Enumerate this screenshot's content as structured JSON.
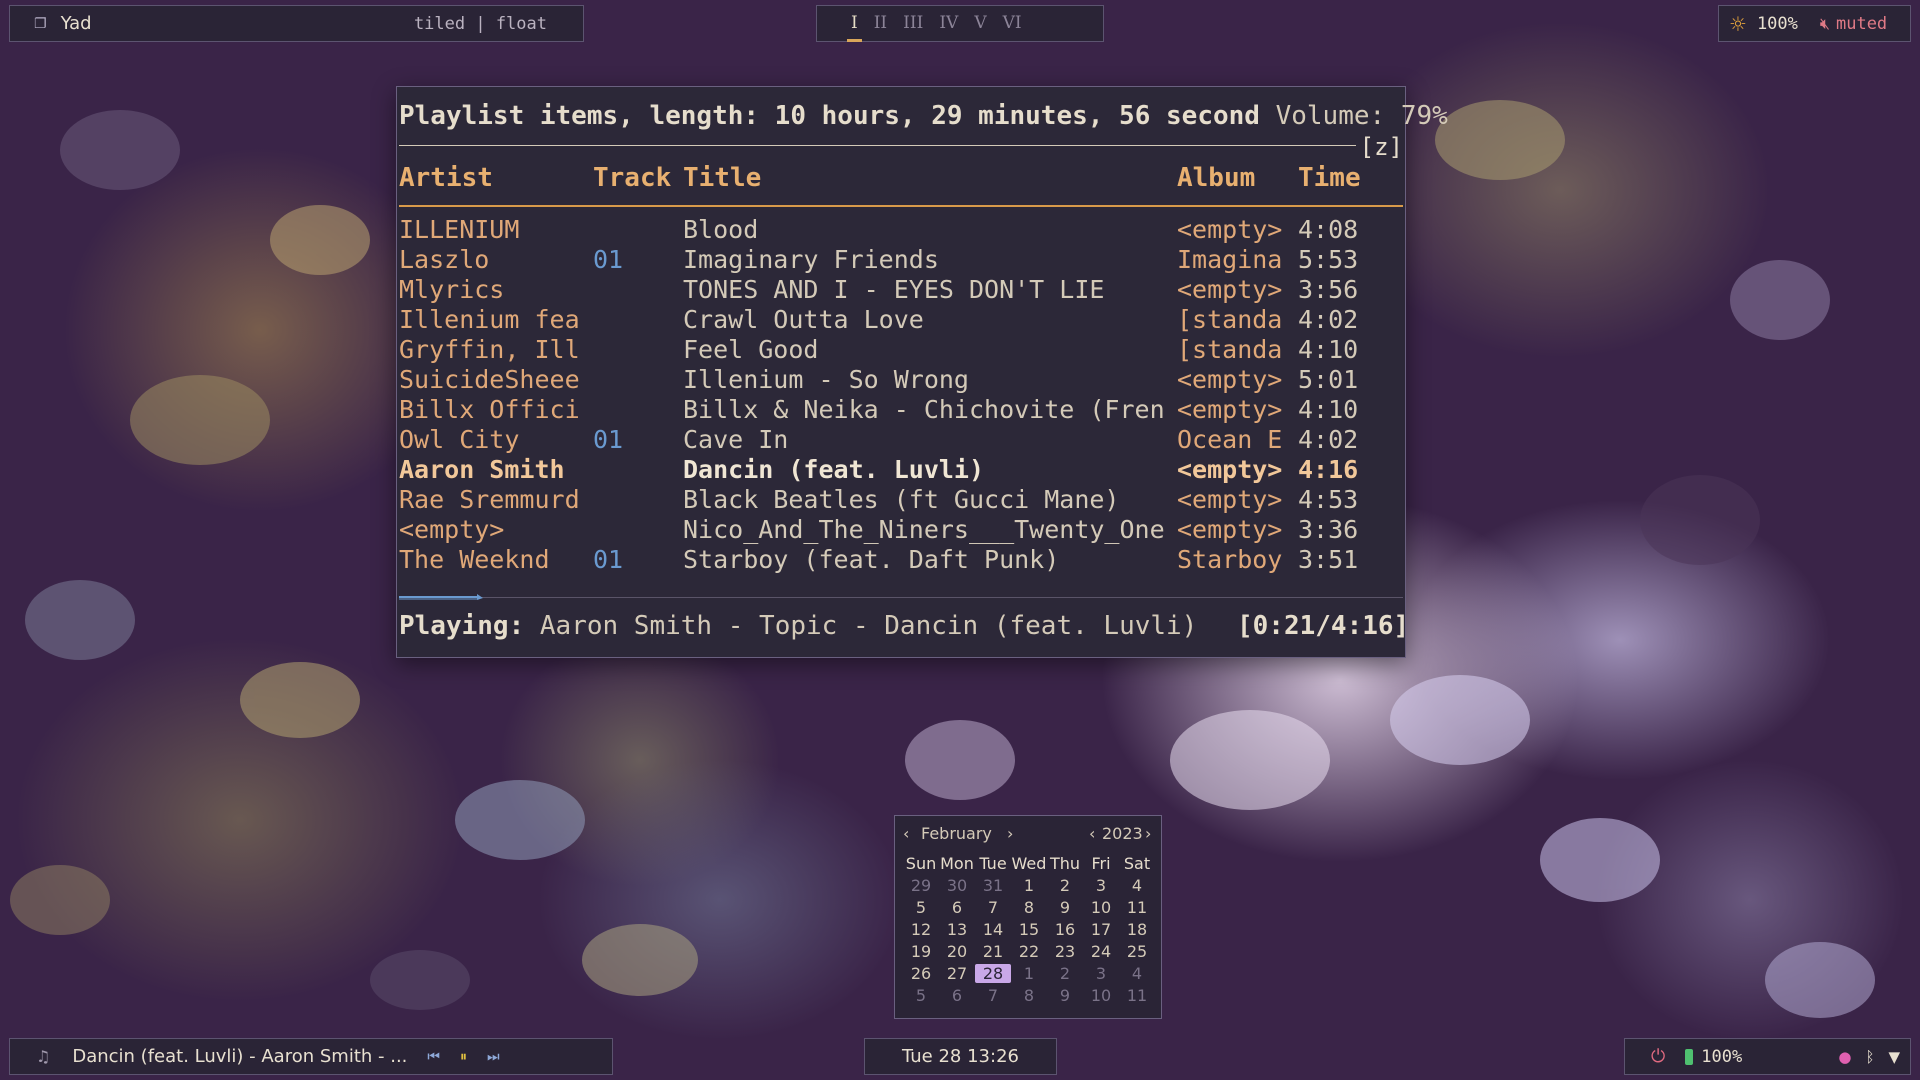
{
  "top_left": {
    "icon": "window-icon",
    "window_title": "Yad",
    "layout": "tiled | float"
  },
  "workspaces": [
    {
      "label": "I",
      "active": true
    },
    {
      "label": "II",
      "active": false
    },
    {
      "label": "III",
      "active": false
    },
    {
      "label": "IV",
      "active": false
    },
    {
      "label": "V",
      "active": false
    },
    {
      "label": "VI",
      "active": false
    }
  ],
  "top_right": {
    "brightness": "100%",
    "volume_state": "muted"
  },
  "terminal": {
    "header": "Playlist items, length: 10 hours, 29 minutes, 56 second",
    "volume": "Volume: 79%",
    "tag": "[z]",
    "columns": {
      "artist": "Artist",
      "track": "Track",
      "title": "Title",
      "album": "Album",
      "time": "Time"
    },
    "rows": [
      {
        "artist": "ILLENIUM",
        "track": "",
        "title": "Blood",
        "album": "<empty>",
        "time": "4:08",
        "current": false
      },
      {
        "artist": "Laszlo",
        "track": "01",
        "title": "Imaginary Friends",
        "album": "Imagina",
        "time": "5:53",
        "current": false
      },
      {
        "artist": "Mlyrics",
        "track": "",
        "title": "TONES AND I - EYES DON'T LIE",
        "album": "<empty>",
        "time": "3:56",
        "current": false
      },
      {
        "artist": "Illenium fea",
        "track": "",
        "title": "Crawl Outta Love",
        "album": "[standa",
        "time": "4:02",
        "current": false
      },
      {
        "artist": "Gryffin, Ill",
        "track": "",
        "title": "Feel Good",
        "album": "[standa",
        "time": "4:10",
        "current": false
      },
      {
        "artist": "SuicideSheee",
        "track": "",
        "title": "Illenium - So Wrong",
        "album": "<empty>",
        "time": "5:01",
        "current": false
      },
      {
        "artist": "Billx Offici",
        "track": "",
        "title": "Billx & Neika - Chichovite (Fren",
        "album": "<empty>",
        "time": "4:10",
        "current": false
      },
      {
        "artist": "Owl City",
        "track": "01",
        "title": "Cave In",
        "album": "Ocean E",
        "time": "4:02",
        "current": false
      },
      {
        "artist": "Aaron Smith",
        "track": "",
        "title": "Dancin (feat. Luvli)",
        "album": "<empty>",
        "time": "4:16",
        "current": true
      },
      {
        "artist": "Rae Sremmurd",
        "track": "",
        "title": "Black Beatles (ft Gucci Mane)",
        "album": "<empty>",
        "time": "4:53",
        "current": false
      },
      {
        "artist": "<empty>",
        "track": "",
        "title": "Nico_And_The_Niners___Twenty_One",
        "album": "<empty>",
        "time": "3:36",
        "current": false
      },
      {
        "artist": "The Weeknd",
        "track": "01",
        "title": "Starboy (feat. Daft Punk)",
        "album": "Starboy",
        "time": "3:51",
        "current": false
      }
    ],
    "playing_label": "Playing:",
    "playing_value": "Aaron Smith - Topic - Dancin (feat. Luvli)",
    "position": "[0:21/4:16]",
    "progress": 0.082
  },
  "calendar": {
    "month": "February",
    "year": "2023",
    "weekdays": [
      "Sun",
      "Mon",
      "Tue",
      "Wed",
      "Thu",
      "Fri",
      "Sat"
    ],
    "weeks": [
      [
        {
          "d": "29",
          "dim": true
        },
        {
          "d": "30",
          "dim": true
        },
        {
          "d": "31",
          "dim": true
        },
        {
          "d": "1"
        },
        {
          "d": "2"
        },
        {
          "d": "3"
        },
        {
          "d": "4"
        }
      ],
      [
        {
          "d": "5"
        },
        {
          "d": "6"
        },
        {
          "d": "7"
        },
        {
          "d": "8"
        },
        {
          "d": "9"
        },
        {
          "d": "10"
        },
        {
          "d": "11"
        }
      ],
      [
        {
          "d": "12"
        },
        {
          "d": "13"
        },
        {
          "d": "14"
        },
        {
          "d": "15"
        },
        {
          "d": "16"
        },
        {
          "d": "17"
        },
        {
          "d": "18"
        }
      ],
      [
        {
          "d": "19"
        },
        {
          "d": "20"
        },
        {
          "d": "21"
        },
        {
          "d": "22"
        },
        {
          "d": "23"
        },
        {
          "d": "24"
        },
        {
          "d": "25"
        }
      ],
      [
        {
          "d": "26"
        },
        {
          "d": "27"
        },
        {
          "d": "28",
          "today": true
        },
        {
          "d": "1",
          "dim": true
        },
        {
          "d": "2",
          "dim": true
        },
        {
          "d": "3",
          "dim": true
        },
        {
          "d": "4",
          "dim": true
        }
      ],
      [
        {
          "d": "5",
          "dim": true
        },
        {
          "d": "6",
          "dim": true
        },
        {
          "d": "7",
          "dim": true
        },
        {
          "d": "8",
          "dim": true
        },
        {
          "d": "9",
          "dim": true
        },
        {
          "d": "10",
          "dim": true
        },
        {
          "d": "11",
          "dim": true
        }
      ]
    ]
  },
  "bottom_left": {
    "now_playing": "Dancin (feat. Luvli) - Aaron Smith - ..."
  },
  "bottom_center": {
    "datetime": "Tue 28 13:26"
  },
  "bottom_right": {
    "battery": "100%"
  },
  "colors": {
    "accent_orange": "#e8b070",
    "track_blue": "#6a9ad0",
    "today_highlight": "#c9a8e8",
    "muted_red": "#e07a86"
  }
}
